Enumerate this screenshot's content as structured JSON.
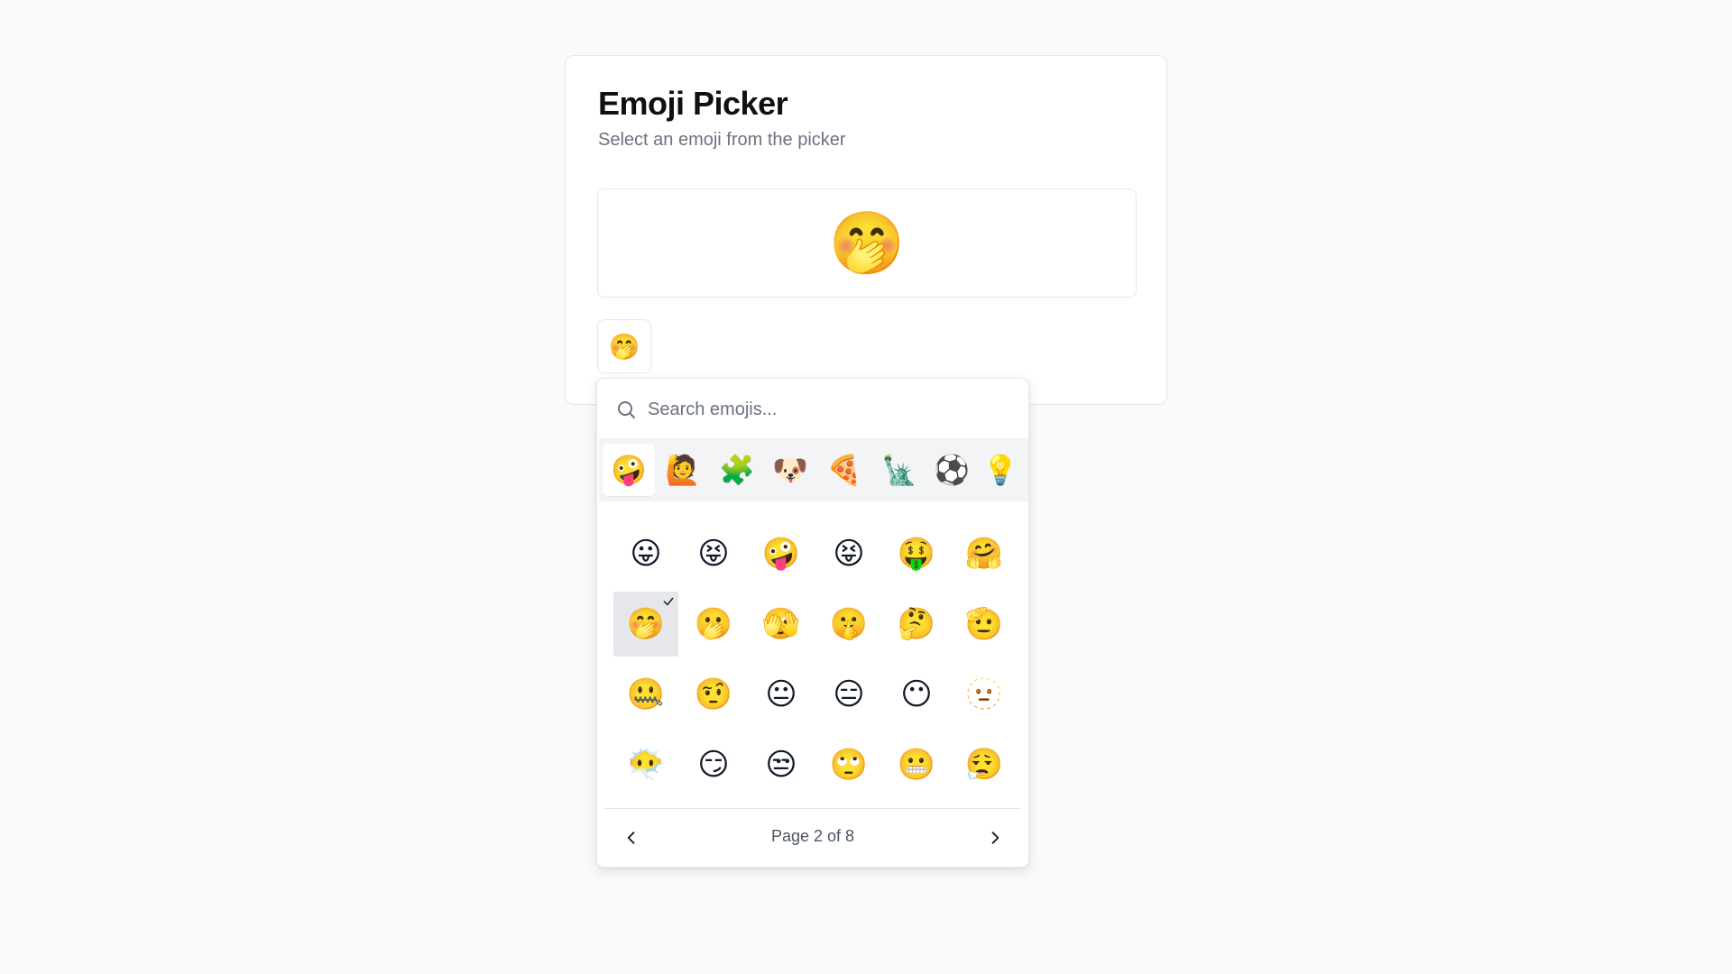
{
  "card": {
    "title": "Emoji Picker",
    "subtitle": "Select an emoji from the picker"
  },
  "selected_emoji": "🤭",
  "trigger_emoji": "🤭",
  "search": {
    "placeholder": "Search emojis...",
    "value": "",
    "icon": "search-icon"
  },
  "categories": [
    {
      "name": "smileys",
      "emoji": "🤪",
      "active": true
    },
    {
      "name": "people",
      "emoji": "🙋",
      "active": false
    },
    {
      "name": "activities",
      "emoji": "🧩",
      "active": false
    },
    {
      "name": "animals",
      "emoji": "🐶",
      "active": false
    },
    {
      "name": "food",
      "emoji": "🍕",
      "active": false
    },
    {
      "name": "travel",
      "emoji": "🗽",
      "active": false
    },
    {
      "name": "sports",
      "emoji": "⚽",
      "active": false
    },
    {
      "name": "objects",
      "emoji": "💡",
      "active": false
    }
  ],
  "grid": [
    [
      "😛",
      "😝",
      "🤪",
      "😝",
      "🤑",
      "🤗"
    ],
    [
      "🤭",
      "🫢",
      "🫣",
      "🤫",
      "🤔",
      "🫡"
    ],
    [
      "🤐",
      "🤨",
      "😐",
      "😑",
      "😶",
      "🫥"
    ],
    [
      "😶‍🌫️",
      "😏",
      "😒",
      "🙄",
      "😬",
      "😮‍💨"
    ]
  ],
  "selected_cell": {
    "row": 1,
    "col": 0
  },
  "pagination": {
    "label": "Page 2 of 8",
    "current": 2,
    "total": 8
  },
  "colors": {
    "background": "#f9fafb",
    "card": "#ffffff",
    "border": "#e5e7eb",
    "category_bar": "#f3f4f6",
    "selected_cell": "#e5e7eb",
    "muted_text": "#6b7280"
  }
}
